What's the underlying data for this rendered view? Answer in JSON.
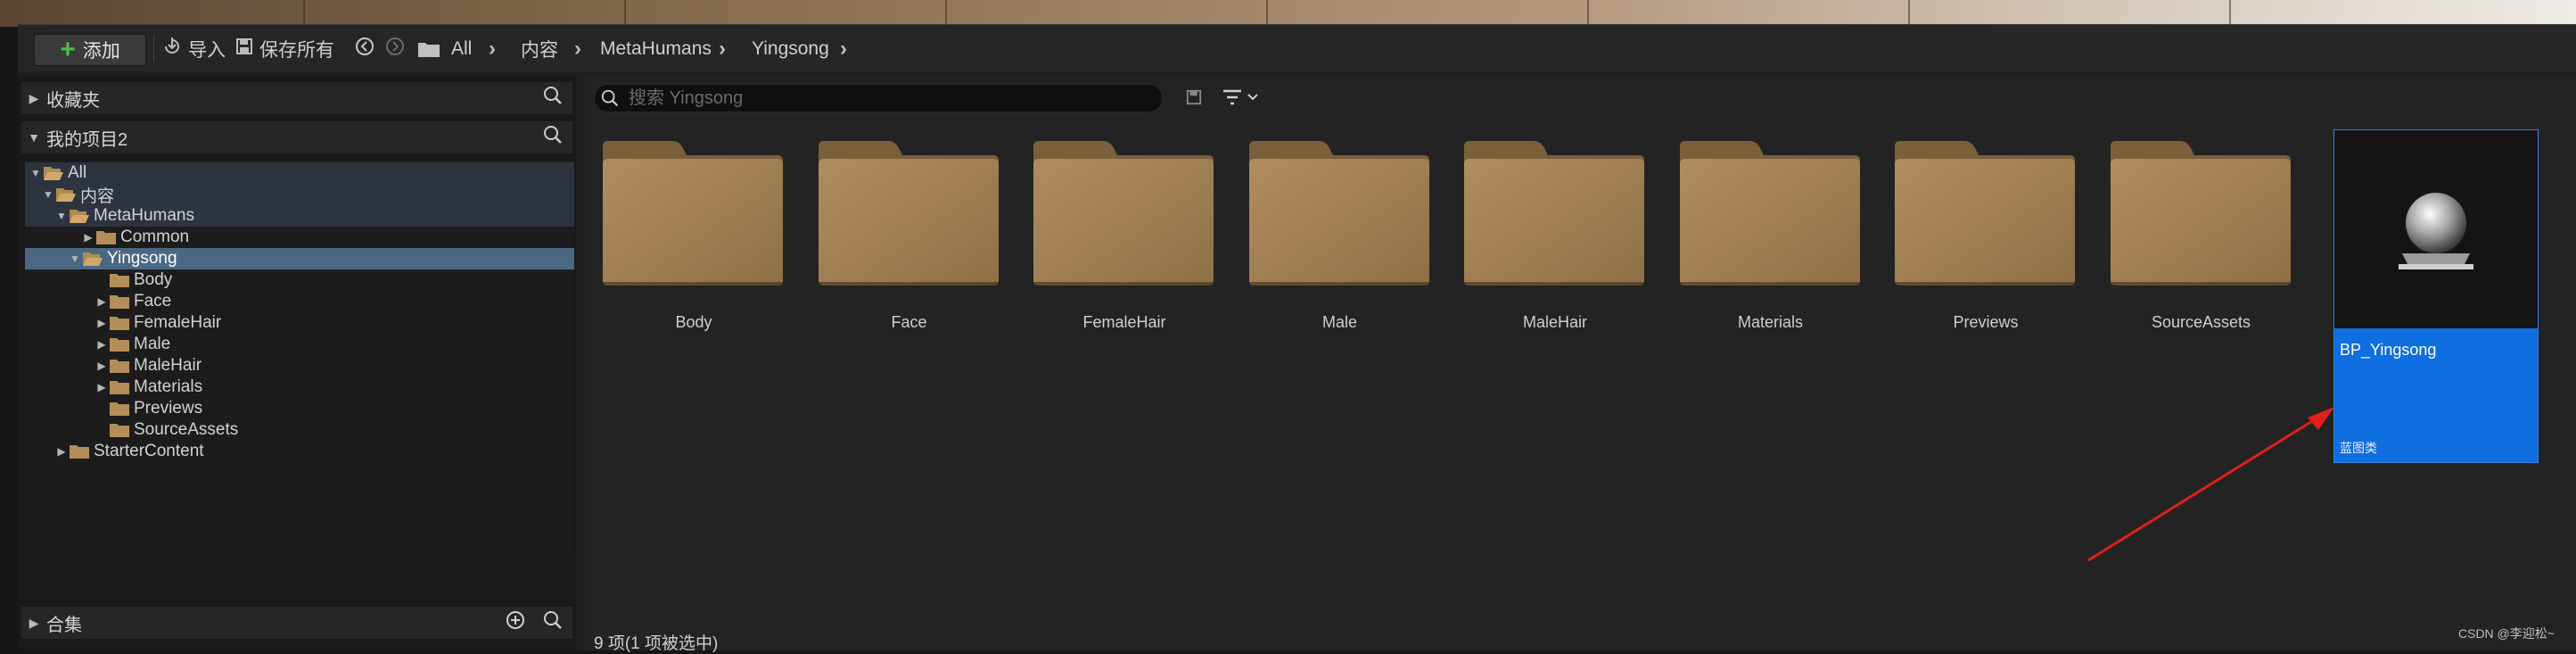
{
  "toolbar": {
    "add_label": "添加",
    "import_label": "导入",
    "save_all_label": "保存所有",
    "breadcrumb": [
      "All",
      "内容",
      "MetaHumans",
      "Yingsong"
    ]
  },
  "left_panel": {
    "favorites_label": "收藏夹",
    "project_label": "我的项目2",
    "collections_label": "合集",
    "tree": [
      {
        "label": "All",
        "expanded": true
      },
      {
        "label": "内容",
        "expanded": true
      },
      {
        "label": "MetaHumans",
        "expanded": true
      },
      {
        "label": "Common",
        "expanded": false
      },
      {
        "label": "Yingsong",
        "expanded": true,
        "selected": true
      },
      {
        "label": "Body"
      },
      {
        "label": "Face",
        "expanded": false
      },
      {
        "label": "FemaleHair",
        "expanded": false
      },
      {
        "label": "Male",
        "expanded": false
      },
      {
        "label": "MaleHair",
        "expanded": false
      },
      {
        "label": "Materials",
        "expanded": false
      },
      {
        "label": "Previews"
      },
      {
        "label": "SourceAssets"
      },
      {
        "label": "StarterContent",
        "expanded": false
      }
    ]
  },
  "main": {
    "search_placeholder": "搜索 Yingsong",
    "folders": [
      "Body",
      "Face",
      "FemaleHair",
      "Male",
      "MaleHair",
      "Materials",
      "Previews",
      "SourceAssets"
    ],
    "asset": {
      "name": "BP_Yingsong",
      "type": "蓝图类"
    },
    "status": "9 项(1 项被选中)"
  },
  "watermark": "CSDN @李迎松~",
  "colors": {
    "folder": "#a8865a",
    "selection": "#0f6ee0",
    "tree_selection": "#4a6783",
    "add_icon": "#45c045",
    "arrow": "#e0201a"
  }
}
